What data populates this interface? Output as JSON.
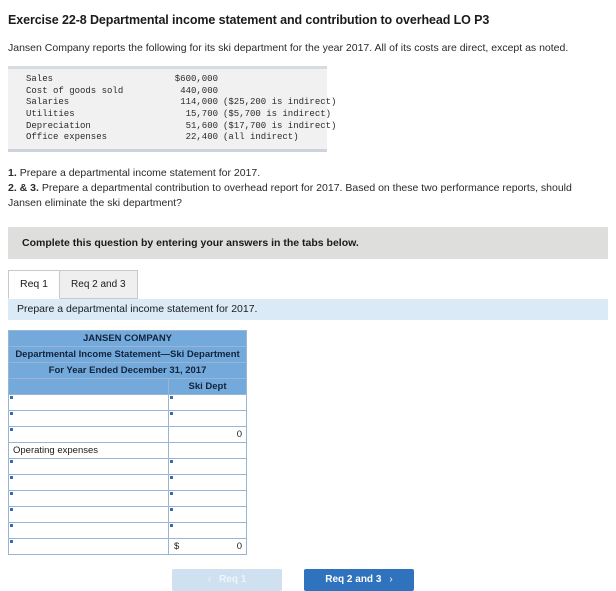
{
  "exercise": {
    "title": "Exercise 22-8 Departmental income statement and contribution to overhead LO P3",
    "intro": "Jansen Company reports the following for its ski department for the year 2017. All of its costs are direct, except as noted."
  },
  "given_data": {
    "rows": [
      {
        "label": "Sales",
        "value": "$600,000",
        "note": ""
      },
      {
        "label": "Cost of goods sold",
        "value": "440,000",
        "note": ""
      },
      {
        "label": "Salaries",
        "value": "114,000",
        "note": "($25,200 is indirect)"
      },
      {
        "label": "Utilities",
        "value": "15,700",
        "note": "($5,700 is indirect)"
      },
      {
        "label": "Depreciation",
        "value": "51,600",
        "note": "($17,700 is indirect)"
      },
      {
        "label": "Office expenses",
        "value": "22,400",
        "note": "(all indirect)"
      }
    ]
  },
  "requirements": {
    "line1_num": "1.",
    "line1_text": "Prepare a departmental income statement for 2017.",
    "line2_num": "2. & 3.",
    "line2_text": "Prepare a departmental contribution to overhead report for 2017. Based on these two performance reports, should Jansen eliminate the ski department?"
  },
  "complete_bar": {
    "text": "Complete this question by entering your answers in the tabs below."
  },
  "tabs": [
    {
      "label": "Req 1",
      "active": true
    },
    {
      "label": "Req 2 and 3",
      "active": false
    }
  ],
  "blue_strip": {
    "text": "Prepare a departmental income statement for 2017."
  },
  "worksheet": {
    "title_line1": "JANSEN COMPANY",
    "title_line2": "Departmental Income Statement—Ski Department",
    "title_line3": "For Year Ended December 31, 2017",
    "col_header_blank": "",
    "col_header_value": "Ski Dept",
    "rows": [
      {
        "type": "input",
        "label": "",
        "value": ""
      },
      {
        "type": "input",
        "label": "",
        "value": ""
      },
      {
        "type": "subtotal",
        "label": "",
        "value": "0"
      },
      {
        "type": "section",
        "label": "Operating expenses",
        "value": ""
      },
      {
        "type": "input",
        "label": "",
        "value": ""
      },
      {
        "type": "input",
        "label": "",
        "value": ""
      },
      {
        "type": "input",
        "label": "",
        "value": ""
      },
      {
        "type": "input",
        "label": "",
        "value": ""
      },
      {
        "type": "input",
        "label": "",
        "value": ""
      },
      {
        "type": "total",
        "label": "",
        "currency": "$",
        "value": "0"
      }
    ]
  },
  "nav": {
    "prev_label": "Req 1",
    "prev_chevron": "‹",
    "next_label": "Req 2 and 3",
    "next_chevron": "›"
  },
  "colors": {
    "header_blue": "#74a9dc",
    "strip_blue": "#daeaf7",
    "button_blue": "#2f72bd",
    "button_disabled": "#cfe0f1",
    "gray_bar": "#dededd"
  }
}
